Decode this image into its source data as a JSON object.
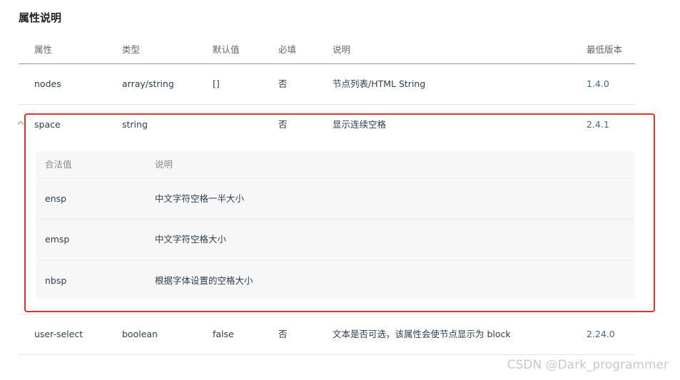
{
  "section_title": "属性说明",
  "headers": [
    "属性",
    "类型",
    "默认值",
    "必填",
    "说明",
    "最低版本"
  ],
  "rows": [
    {
      "name": "nodes",
      "type": "array/string",
      "default": "[]",
      "required": "否",
      "desc": "节点列表/HTML String",
      "version": "1.4.0"
    },
    {
      "name": "space",
      "type": "string",
      "default": "",
      "required": "否",
      "desc": "显示连续空格",
      "version": "2.4.1"
    },
    {
      "name": "user-select",
      "type": "boolean",
      "default": "false",
      "required": "否",
      "desc": "文本是否可选，该属性会使节点显示为 block",
      "version": "2.24.0"
    }
  ],
  "sub_table": {
    "headers": [
      "合法值",
      "说明"
    ],
    "rows": [
      {
        "value": "ensp",
        "desc": "中文字符空格一半大小"
      },
      {
        "value": "emsp",
        "desc": "中文字符空格大小"
      },
      {
        "value": "nbsp",
        "desc": "根据字体设置的空格大小"
      }
    ]
  },
  "watermark": "CSDN @Dark_programmer",
  "colors": {
    "link": "#3f6a9e",
    "highlight": "#e0302c",
    "sub_table_bg": "#f7f7f7"
  }
}
